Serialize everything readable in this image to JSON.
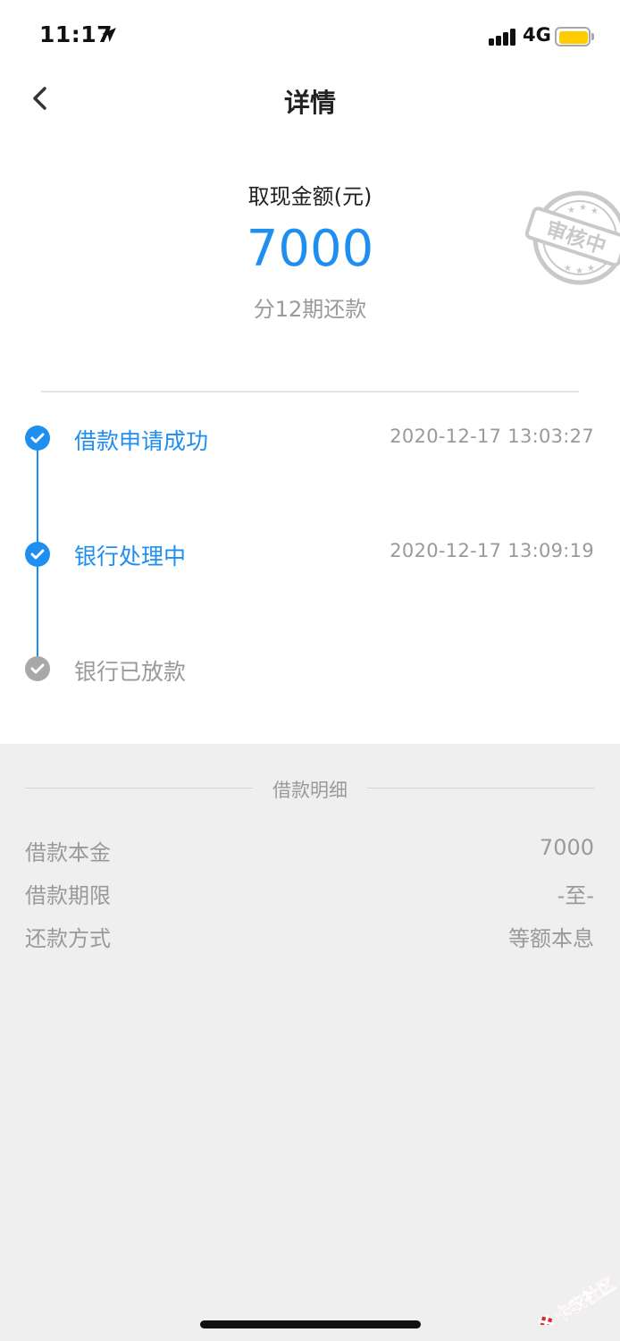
{
  "status_bar": {
    "time": "11:17",
    "network": "4G"
  },
  "header": {
    "title": "详情"
  },
  "amount": {
    "label": "取现金额(元)",
    "value": "7000",
    "installments": "分12期还款"
  },
  "stamp": {
    "text": "审核中"
  },
  "timeline": [
    {
      "label": "借款申请成功",
      "time": "2020-12-17 13:03:27",
      "status": "done"
    },
    {
      "label": "银行处理中",
      "time": "2020-12-17 13:09:19",
      "status": "done"
    },
    {
      "label": "银行已放款",
      "time": "",
      "status": "pending"
    }
  ],
  "details": {
    "title": "借款明细",
    "rows": [
      {
        "label": "借款本金",
        "value": "7000"
      },
      {
        "label": "借款期限",
        "value": "-至-"
      },
      {
        "label": "还款方式",
        "value": "等额本息"
      }
    ]
  },
  "watermark": {
    "text": "卡农社区"
  },
  "colors": {
    "accent": "#1f8ef1",
    "muted": "#9a9a9a",
    "pending": "#a8a8a8",
    "background": "#efefef"
  }
}
